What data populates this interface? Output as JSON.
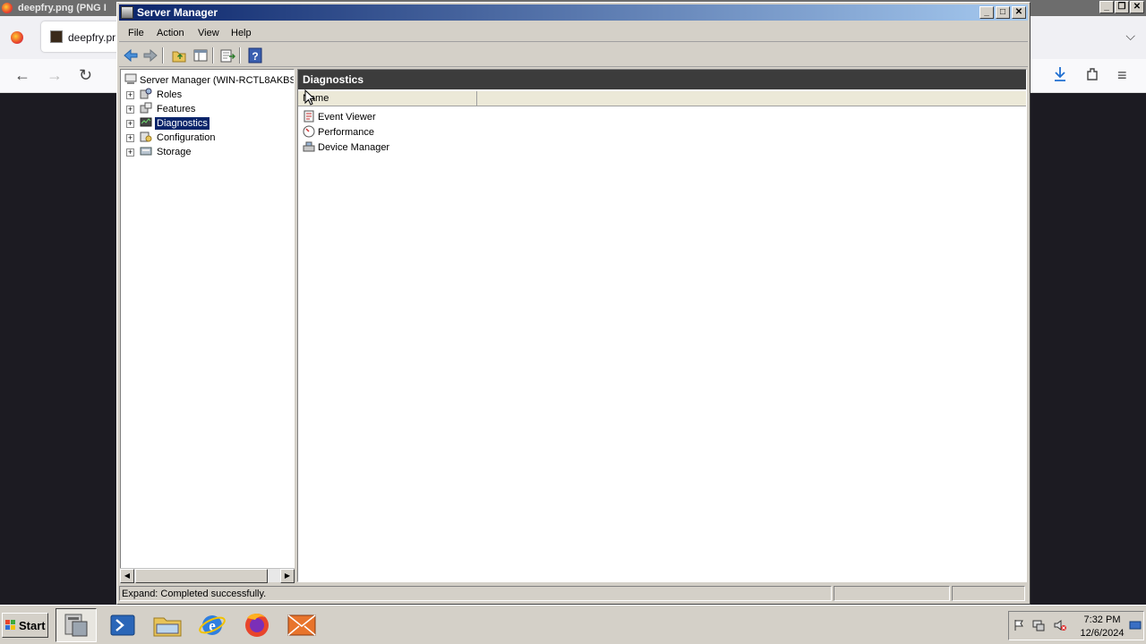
{
  "firefox": {
    "title": "deepfry.png (PNG I",
    "tab_label": "deepfry.pr",
    "back_icon": "arrow-left-icon",
    "forward_icon": "arrow-right-icon",
    "reload_icon": "reload-icon"
  },
  "window": {
    "title": "Server Manager",
    "controls": [
      "minimize",
      "maximize",
      "close"
    ]
  },
  "menu": [
    "File",
    "Action",
    "View",
    "Help"
  ],
  "toolbar": [
    "back-icon",
    "forward-icon",
    "up-folder-icon",
    "show-hide-tree-icon",
    "export-list-icon",
    "help-icon"
  ],
  "tree": {
    "root": "Server Manager (WIN-RCTL8AKBS(",
    "nodes": [
      {
        "label": "Roles",
        "expander": "+"
      },
      {
        "label": "Features",
        "expander": "+"
      },
      {
        "label": "Diagnostics",
        "expander": "+",
        "selected": true
      },
      {
        "label": "Configuration",
        "expander": "+"
      },
      {
        "label": "Storage",
        "expander": "+"
      }
    ]
  },
  "main": {
    "header": "Diagnostics",
    "column_name": "Name",
    "items": [
      "Event Viewer",
      "Performance",
      "Device Manager"
    ]
  },
  "status": {
    "text": "Expand:  Completed successfully."
  },
  "taskbar": {
    "start": "Start",
    "apps": [
      "server-manager-icon",
      "powershell-icon",
      "explorer-icon",
      "internet-explorer-icon",
      "firefox-icon",
      "app-icon"
    ],
    "clock_time": "7:32 PM",
    "clock_date": "12/6/2024"
  },
  "colors": {
    "title_gradient_start": "#0a246a",
    "title_gradient_end": "#a6caf0",
    "selection": "#0a246a",
    "pane_header": "#3c3c3c",
    "chrome": "#d4d0c8"
  }
}
